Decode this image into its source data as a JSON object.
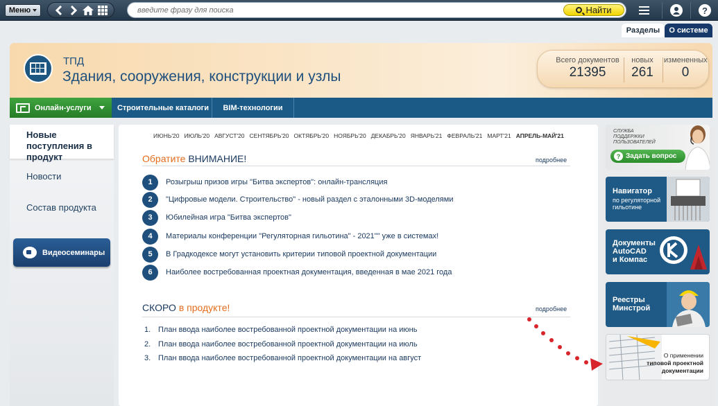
{
  "toolbar": {
    "menu_label": "Меню",
    "search_placeholder": "введите фразу для поиска",
    "find_label": "Найти",
    "help_label": "?"
  },
  "top_tabs": [
    "Разделы",
    "О системе"
  ],
  "header": {
    "abbr": "ТПД",
    "title": "Здания, сооружения, конструкции и узлы",
    "counts": [
      {
        "label": "Всего документов",
        "value": "21395"
      },
      {
        "label": "новых",
        "value": "261"
      },
      {
        "label": "измененных",
        "value": "0"
      }
    ]
  },
  "nav": {
    "online_label": "Онлайн-услуги",
    "items": [
      "Строительные каталоги",
      "BIM-технологии"
    ]
  },
  "sidebar": {
    "items": [
      "Новые поступления в продукт",
      "Новости",
      "Состав продукта"
    ],
    "video_label": "Видеосеминары"
  },
  "months": [
    "ИЮНЬ'20",
    "ИЮЛЬ'20",
    "АВГУСТ'20",
    "СЕНТЯБРЬ'20",
    "ОКТЯБРЬ'20",
    "НОЯБРЬ'20",
    "ДЕКАБРЬ'20",
    "ЯНВАРЬ'21",
    "ФЕВРАЛЬ'21",
    "МАРТ'21",
    "АПРЕЛЬ-МАЙ'21"
  ],
  "attention": {
    "title_a": "Обратите ",
    "title_b": "ВНИМАНИЕ!",
    "more": "подробнее",
    "items": [
      "Розыгрыш призов игры \"Битва экспертов\": онлайн-трансляция",
      "\"Цифровые модели. Строительство\" - новый раздел с эталонными 3D-моделями",
      "Юбилейная игра \"Битва экспертов\"",
      "Материалы конференции \"Регуляторная гильотина\" - 2021\"\" уже в системах!",
      "В Градкодексе могут установить критерии типовой проектной документации",
      "Наиболее востребованная проектная документация, введенная в мае 2021 года"
    ]
  },
  "soon": {
    "title_a": "СКОРО ",
    "title_b": "в продукте!",
    "more": "подробнее",
    "items": [
      "План ввода наиболее востребованной проектной документации на июнь",
      "План ввода наиболее востребованной проектной документации на июль",
      "План ввода наиболее востребованной проектной документации на август"
    ]
  },
  "banners": {
    "support_text": [
      "СЛУЖБА",
      "ПОДДЕРЖКИ",
      "ПОЛЬЗОВАТЕЛЕЙ"
    ],
    "ask_label": "Задать вопрос",
    "navigator": {
      "title": "Навигатор",
      "sub": "по регуляторной гильотине"
    },
    "autocad": [
      "Документы",
      "AutoCAD",
      "и Компас"
    ],
    "registry": [
      "Реестры",
      "Минстрой"
    ],
    "typical": {
      "line1": "О применении",
      "line2": "типовой проектной",
      "line3": "документации"
    }
  },
  "colors": {
    "accent": "#1f5a86",
    "orange": "#e46c1e",
    "green": "#2c8c2c",
    "find": "#f2d600"
  }
}
